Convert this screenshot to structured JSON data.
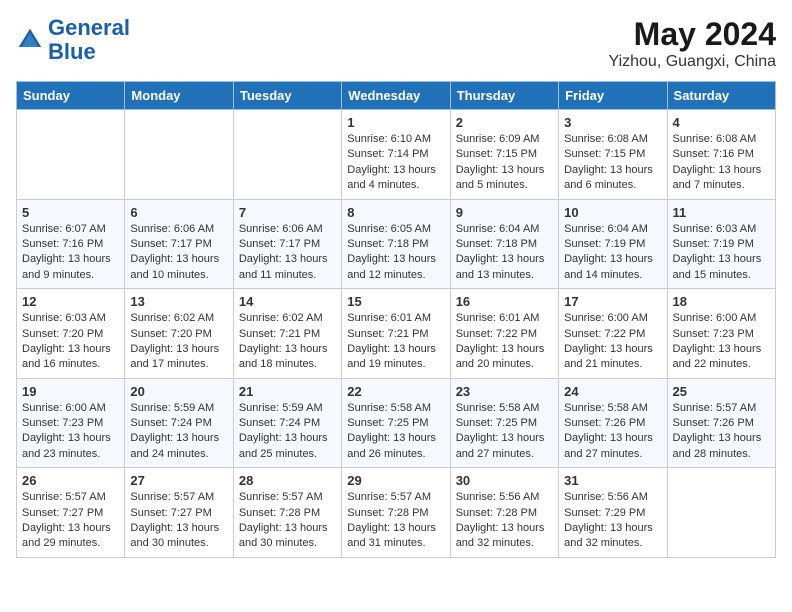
{
  "header": {
    "logo_general": "General",
    "logo_blue": "Blue",
    "title": "May 2024",
    "subtitle": "Yizhou, Guangxi, China"
  },
  "days_of_week": [
    "Sunday",
    "Monday",
    "Tuesday",
    "Wednesday",
    "Thursday",
    "Friday",
    "Saturday"
  ],
  "weeks": [
    {
      "days": [
        {
          "number": "",
          "empty": true
        },
        {
          "number": "",
          "empty": true
        },
        {
          "number": "",
          "empty": true
        },
        {
          "number": "1",
          "sunrise": "6:10 AM",
          "sunset": "7:14 PM",
          "daylight": "13 hours and 4 minutes."
        },
        {
          "number": "2",
          "sunrise": "6:09 AM",
          "sunset": "7:15 PM",
          "daylight": "13 hours and 5 minutes."
        },
        {
          "number": "3",
          "sunrise": "6:08 AM",
          "sunset": "7:15 PM",
          "daylight": "13 hours and 6 minutes."
        },
        {
          "number": "4",
          "sunrise": "6:08 AM",
          "sunset": "7:16 PM",
          "daylight": "13 hours and 7 minutes."
        }
      ]
    },
    {
      "days": [
        {
          "number": "5",
          "sunrise": "6:07 AM",
          "sunset": "7:16 PM",
          "daylight": "13 hours and 9 minutes."
        },
        {
          "number": "6",
          "sunrise": "6:06 AM",
          "sunset": "7:17 PM",
          "daylight": "13 hours and 10 minutes."
        },
        {
          "number": "7",
          "sunrise": "6:06 AM",
          "sunset": "7:17 PM",
          "daylight": "13 hours and 11 minutes."
        },
        {
          "number": "8",
          "sunrise": "6:05 AM",
          "sunset": "7:18 PM",
          "daylight": "13 hours and 12 minutes."
        },
        {
          "number": "9",
          "sunrise": "6:04 AM",
          "sunset": "7:18 PM",
          "daylight": "13 hours and 13 minutes."
        },
        {
          "number": "10",
          "sunrise": "6:04 AM",
          "sunset": "7:19 PM",
          "daylight": "13 hours and 14 minutes."
        },
        {
          "number": "11",
          "sunrise": "6:03 AM",
          "sunset": "7:19 PM",
          "daylight": "13 hours and 15 minutes."
        }
      ]
    },
    {
      "days": [
        {
          "number": "12",
          "sunrise": "6:03 AM",
          "sunset": "7:20 PM",
          "daylight": "13 hours and 16 minutes."
        },
        {
          "number": "13",
          "sunrise": "6:02 AM",
          "sunset": "7:20 PM",
          "daylight": "13 hours and 17 minutes."
        },
        {
          "number": "14",
          "sunrise": "6:02 AM",
          "sunset": "7:21 PM",
          "daylight": "13 hours and 18 minutes."
        },
        {
          "number": "15",
          "sunrise": "6:01 AM",
          "sunset": "7:21 PM",
          "daylight": "13 hours and 19 minutes."
        },
        {
          "number": "16",
          "sunrise": "6:01 AM",
          "sunset": "7:22 PM",
          "daylight": "13 hours and 20 minutes."
        },
        {
          "number": "17",
          "sunrise": "6:00 AM",
          "sunset": "7:22 PM",
          "daylight": "13 hours and 21 minutes."
        },
        {
          "number": "18",
          "sunrise": "6:00 AM",
          "sunset": "7:23 PM",
          "daylight": "13 hours and 22 minutes."
        }
      ]
    },
    {
      "days": [
        {
          "number": "19",
          "sunrise": "6:00 AM",
          "sunset": "7:23 PM",
          "daylight": "13 hours and 23 minutes."
        },
        {
          "number": "20",
          "sunrise": "5:59 AM",
          "sunset": "7:24 PM",
          "daylight": "13 hours and 24 minutes."
        },
        {
          "number": "21",
          "sunrise": "5:59 AM",
          "sunset": "7:24 PM",
          "daylight": "13 hours and 25 minutes."
        },
        {
          "number": "22",
          "sunrise": "5:58 AM",
          "sunset": "7:25 PM",
          "daylight": "13 hours and 26 minutes."
        },
        {
          "number": "23",
          "sunrise": "5:58 AM",
          "sunset": "7:25 PM",
          "daylight": "13 hours and 27 minutes."
        },
        {
          "number": "24",
          "sunrise": "5:58 AM",
          "sunset": "7:26 PM",
          "daylight": "13 hours and 27 minutes."
        },
        {
          "number": "25",
          "sunrise": "5:57 AM",
          "sunset": "7:26 PM",
          "daylight": "13 hours and 28 minutes."
        }
      ]
    },
    {
      "days": [
        {
          "number": "26",
          "sunrise": "5:57 AM",
          "sunset": "7:27 PM",
          "daylight": "13 hours and 29 minutes."
        },
        {
          "number": "27",
          "sunrise": "5:57 AM",
          "sunset": "7:27 PM",
          "daylight": "13 hours and 30 minutes."
        },
        {
          "number": "28",
          "sunrise": "5:57 AM",
          "sunset": "7:28 PM",
          "daylight": "13 hours and 30 minutes."
        },
        {
          "number": "29",
          "sunrise": "5:57 AM",
          "sunset": "7:28 PM",
          "daylight": "13 hours and 31 minutes."
        },
        {
          "number": "30",
          "sunrise": "5:56 AM",
          "sunset": "7:28 PM",
          "daylight": "13 hours and 32 minutes."
        },
        {
          "number": "31",
          "sunrise": "5:56 AM",
          "sunset": "7:29 PM",
          "daylight": "13 hours and 32 minutes."
        },
        {
          "number": "",
          "empty": true
        }
      ]
    }
  ]
}
